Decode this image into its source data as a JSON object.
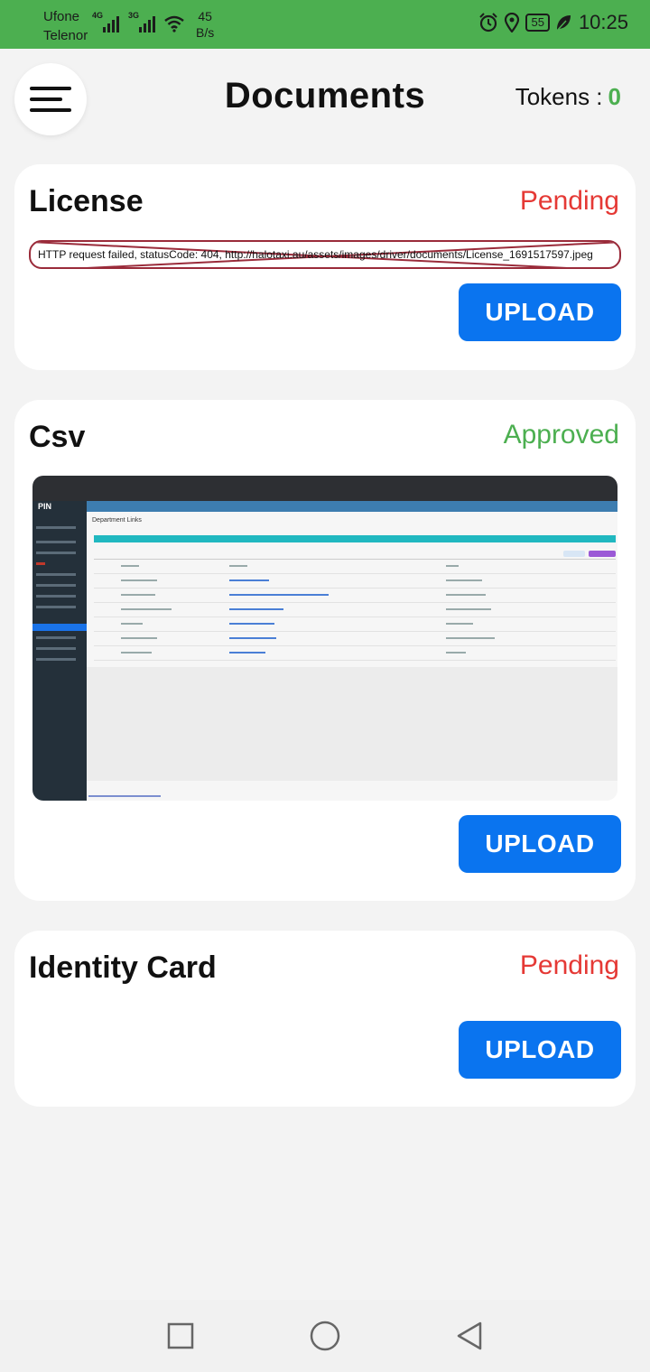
{
  "status_bar": {
    "carrier_1": "Ufone",
    "carrier_2": "Telenor",
    "net_tag_1": "4G",
    "net_tag_2": "3G",
    "speed_value": "45",
    "speed_unit": "B/s",
    "battery": "55",
    "time": "10:25",
    "background_color": "#4caf50",
    "icons": [
      "signal-icon",
      "wifi-icon",
      "alarm-icon",
      "location-icon",
      "battery-icon",
      "leaf-icon"
    ]
  },
  "header": {
    "title": "Documents",
    "tokens_label": "Tokens :",
    "tokens_value": "0",
    "menu_icon": "hamburger-menu-icon"
  },
  "documents": [
    {
      "title": "License",
      "status": "Pending",
      "error_text": "HTTP request failed, statusCode: 404, http://halotaxi.au/assets/images/driver/documents/License_1691517597.jpeg",
      "upload_label": "UPLOAD"
    },
    {
      "title": "Csv",
      "status": "Approved",
      "upload_label": "UPLOAD",
      "thumbnail": {
        "logo": "PIN",
        "heading": "Department Links"
      }
    },
    {
      "title": "Identity Card",
      "status": "Pending",
      "upload_label": "UPLOAD"
    }
  ],
  "colors": {
    "pending": "#e53935",
    "approved": "#4caf50",
    "upload_button": "#0a74ef",
    "tokens_value": "#4caf50"
  },
  "nav_bar": {
    "icons": [
      "recents-square-icon",
      "home-circle-icon",
      "back-triangle-icon"
    ]
  }
}
